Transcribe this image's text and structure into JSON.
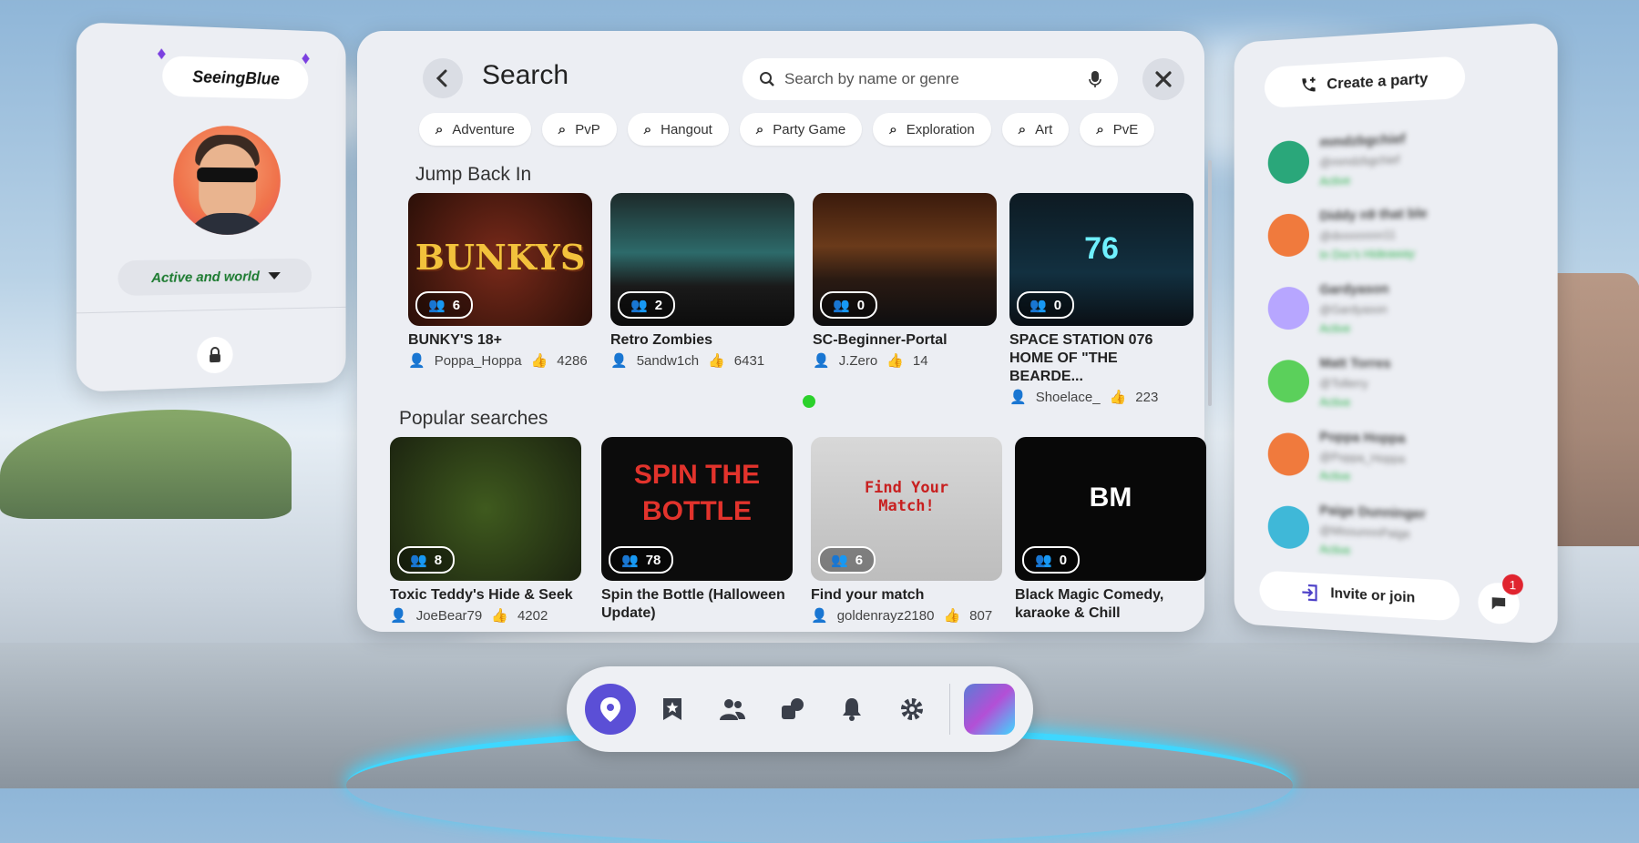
{
  "profile": {
    "username": "SeeingBlue",
    "status": "Active and world",
    "gem_left": "♦",
    "gem_right": "♦"
  },
  "search": {
    "title": "Search",
    "placeholder": "Search by name or genre",
    "chips": [
      "Adventure",
      "PvP",
      "Hangout",
      "Party Game",
      "Exploration",
      "Art",
      "PvE"
    ],
    "sections": {
      "jump_back_in": "Jump Back In",
      "popular": "Popular searches"
    },
    "jump_back_in": [
      {
        "title": "BUNKY'S 18+",
        "players": "6",
        "author": "Poppa_Hoppa",
        "likes": "4286",
        "thumb_text": "BUNKYS"
      },
      {
        "title": "Retro Zombies",
        "players": "2",
        "author": "5andw1ch",
        "likes": "6431",
        "thumb_text": ""
      },
      {
        "title": "SC-Beginner-Portal",
        "players": "0",
        "author": "J.Zero",
        "likes": "14",
        "thumb_text": ""
      },
      {
        "title": "SPACE STATION 076 HOME OF \"THE BEARDE...",
        "players": "0",
        "author": "Shoelace_",
        "likes": "223",
        "thumb_text": "76"
      }
    ],
    "popular": [
      {
        "title": "Toxic Teddy's Hide & Seek",
        "players": "8",
        "author": "JoeBear79",
        "likes": "4202",
        "thumb_text": ""
      },
      {
        "title": "Spin the Bottle (Halloween Update)",
        "players": "78",
        "author": "",
        "likes": "",
        "thumb_text": "SPIN THE BOTTLE"
      },
      {
        "title": "Find your match",
        "players": "6",
        "author": "goldenrayz2180",
        "likes": "807",
        "thumb_text": "Find Your Match!"
      },
      {
        "title": "Black Magic Comedy, karaoke & Chill",
        "players": "0",
        "author": "",
        "likes": "",
        "thumb_text": "BM"
      }
    ]
  },
  "party": {
    "create_label": "Create a party",
    "invite_label": "Invite or join",
    "chat_badge": "1",
    "friends": [
      {
        "name": "mmdzbgchief",
        "handle": "@mmdzbgchief",
        "status": "Active",
        "color": "#2aa77a"
      },
      {
        "name": "Diddy n9 that ble",
        "handle": "@dxxxxxxxx11",
        "status": "In Doc's Hideaway",
        "color": "#f07a3d"
      },
      {
        "name": "Gardyason",
        "handle": "@Gardyason",
        "status": "Active",
        "color": "#b7a6ff"
      },
      {
        "name": "Matt Torres",
        "handle": "@Tollerry",
        "status": "Active",
        "color": "#5bd05b"
      },
      {
        "name": "Poppa Hoppa",
        "handle": "@Poppa_Hoppa",
        "status": "Active",
        "color": "#f07a3d"
      },
      {
        "name": "Paige Dunninger",
        "handle": "@MissunnnPaige",
        "status": "Active",
        "color": "#3fb8d8"
      }
    ]
  },
  "dock": {
    "items": [
      "location-icon",
      "bookmark-star-icon",
      "people-icon",
      "shapes-icon",
      "bell-icon",
      "gear-icon"
    ]
  }
}
